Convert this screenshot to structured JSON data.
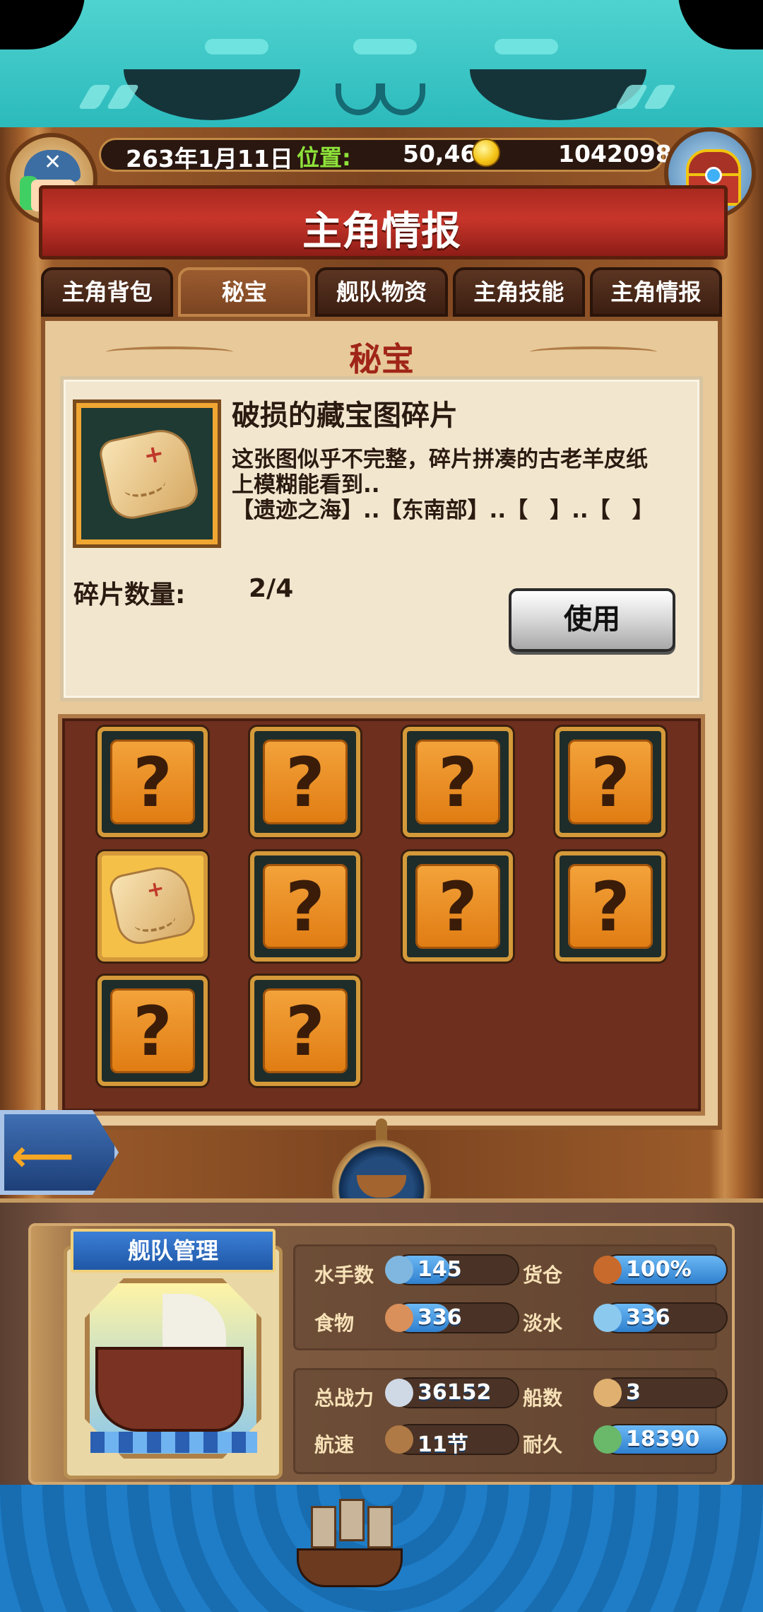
{
  "status": {
    "date": "263年1月11日",
    "position_label": "位置:",
    "position": "50,46",
    "gold": "1042098"
  },
  "header": {
    "title": "主角情报"
  },
  "tabs": [
    {
      "label": "主角背包",
      "active": false
    },
    {
      "label": "秘宝",
      "active": true
    },
    {
      "label": "舰队物资",
      "active": false
    },
    {
      "label": "主角技能",
      "active": false
    },
    {
      "label": "主角情报",
      "active": false
    }
  ],
  "panel": {
    "title": "秘宝"
  },
  "item": {
    "name": "破损的藏宝图碎片",
    "desc_line1": "这张图似乎不完整，碎片拼凑的古老羊皮纸",
    "desc_line2": "上模糊能看到..",
    "desc_line3": "【遗迹之海】..【东南部】..【　】..【　】",
    "fragment_label": "碎片数量:",
    "fragment_count": "2/4",
    "use_label": "使用",
    "question_mark": "?",
    "map_mark": "+"
  },
  "grid": {
    "slots": [
      {
        "state": "unknown"
      },
      {
        "state": "unknown"
      },
      {
        "state": "unknown"
      },
      {
        "state": "unknown"
      },
      {
        "state": "owned"
      },
      {
        "state": "unknown"
      },
      {
        "state": "unknown"
      },
      {
        "state": "unknown"
      },
      {
        "state": "unknown"
      },
      {
        "state": "unknown"
      }
    ]
  },
  "back_button": {
    "arrow": "⟵"
  },
  "fleet": {
    "banner": "舰队管理",
    "stats_top": [
      {
        "label": "水手数",
        "value": "145",
        "fill": 0.45,
        "icon": "sailor-icon",
        "color": "#7fb7e0"
      },
      {
        "label": "货仓",
        "value": "100%",
        "fill": 1.0,
        "icon": "cargo-icon",
        "color": "#c86a2c"
      },
      {
        "label": "食物",
        "value": "336",
        "fill": 0.45,
        "icon": "meat-icon",
        "color": "#d9905a"
      },
      {
        "label": "淡水",
        "value": "336",
        "fill": 0.45,
        "icon": "water-icon",
        "color": "#8bc9ef"
      }
    ],
    "stats_bottom": [
      {
        "label": "总战力",
        "value": "36152",
        "fill": 0.0,
        "icon": "sword-icon",
        "color": "#cfd9e6"
      },
      {
        "label": "船数",
        "value": "3",
        "fill": 0.0,
        "icon": "ship-count-icon",
        "color": "#e0b070"
      },
      {
        "label": "航速",
        "value": "11节",
        "fill": 0.0,
        "icon": "speed-icon",
        "color": "#b07a46"
      },
      {
        "label": "耐久",
        "value": "18390",
        "fill": 1.0,
        "icon": "durability-icon",
        "color": "#6ab86a"
      }
    ]
  }
}
